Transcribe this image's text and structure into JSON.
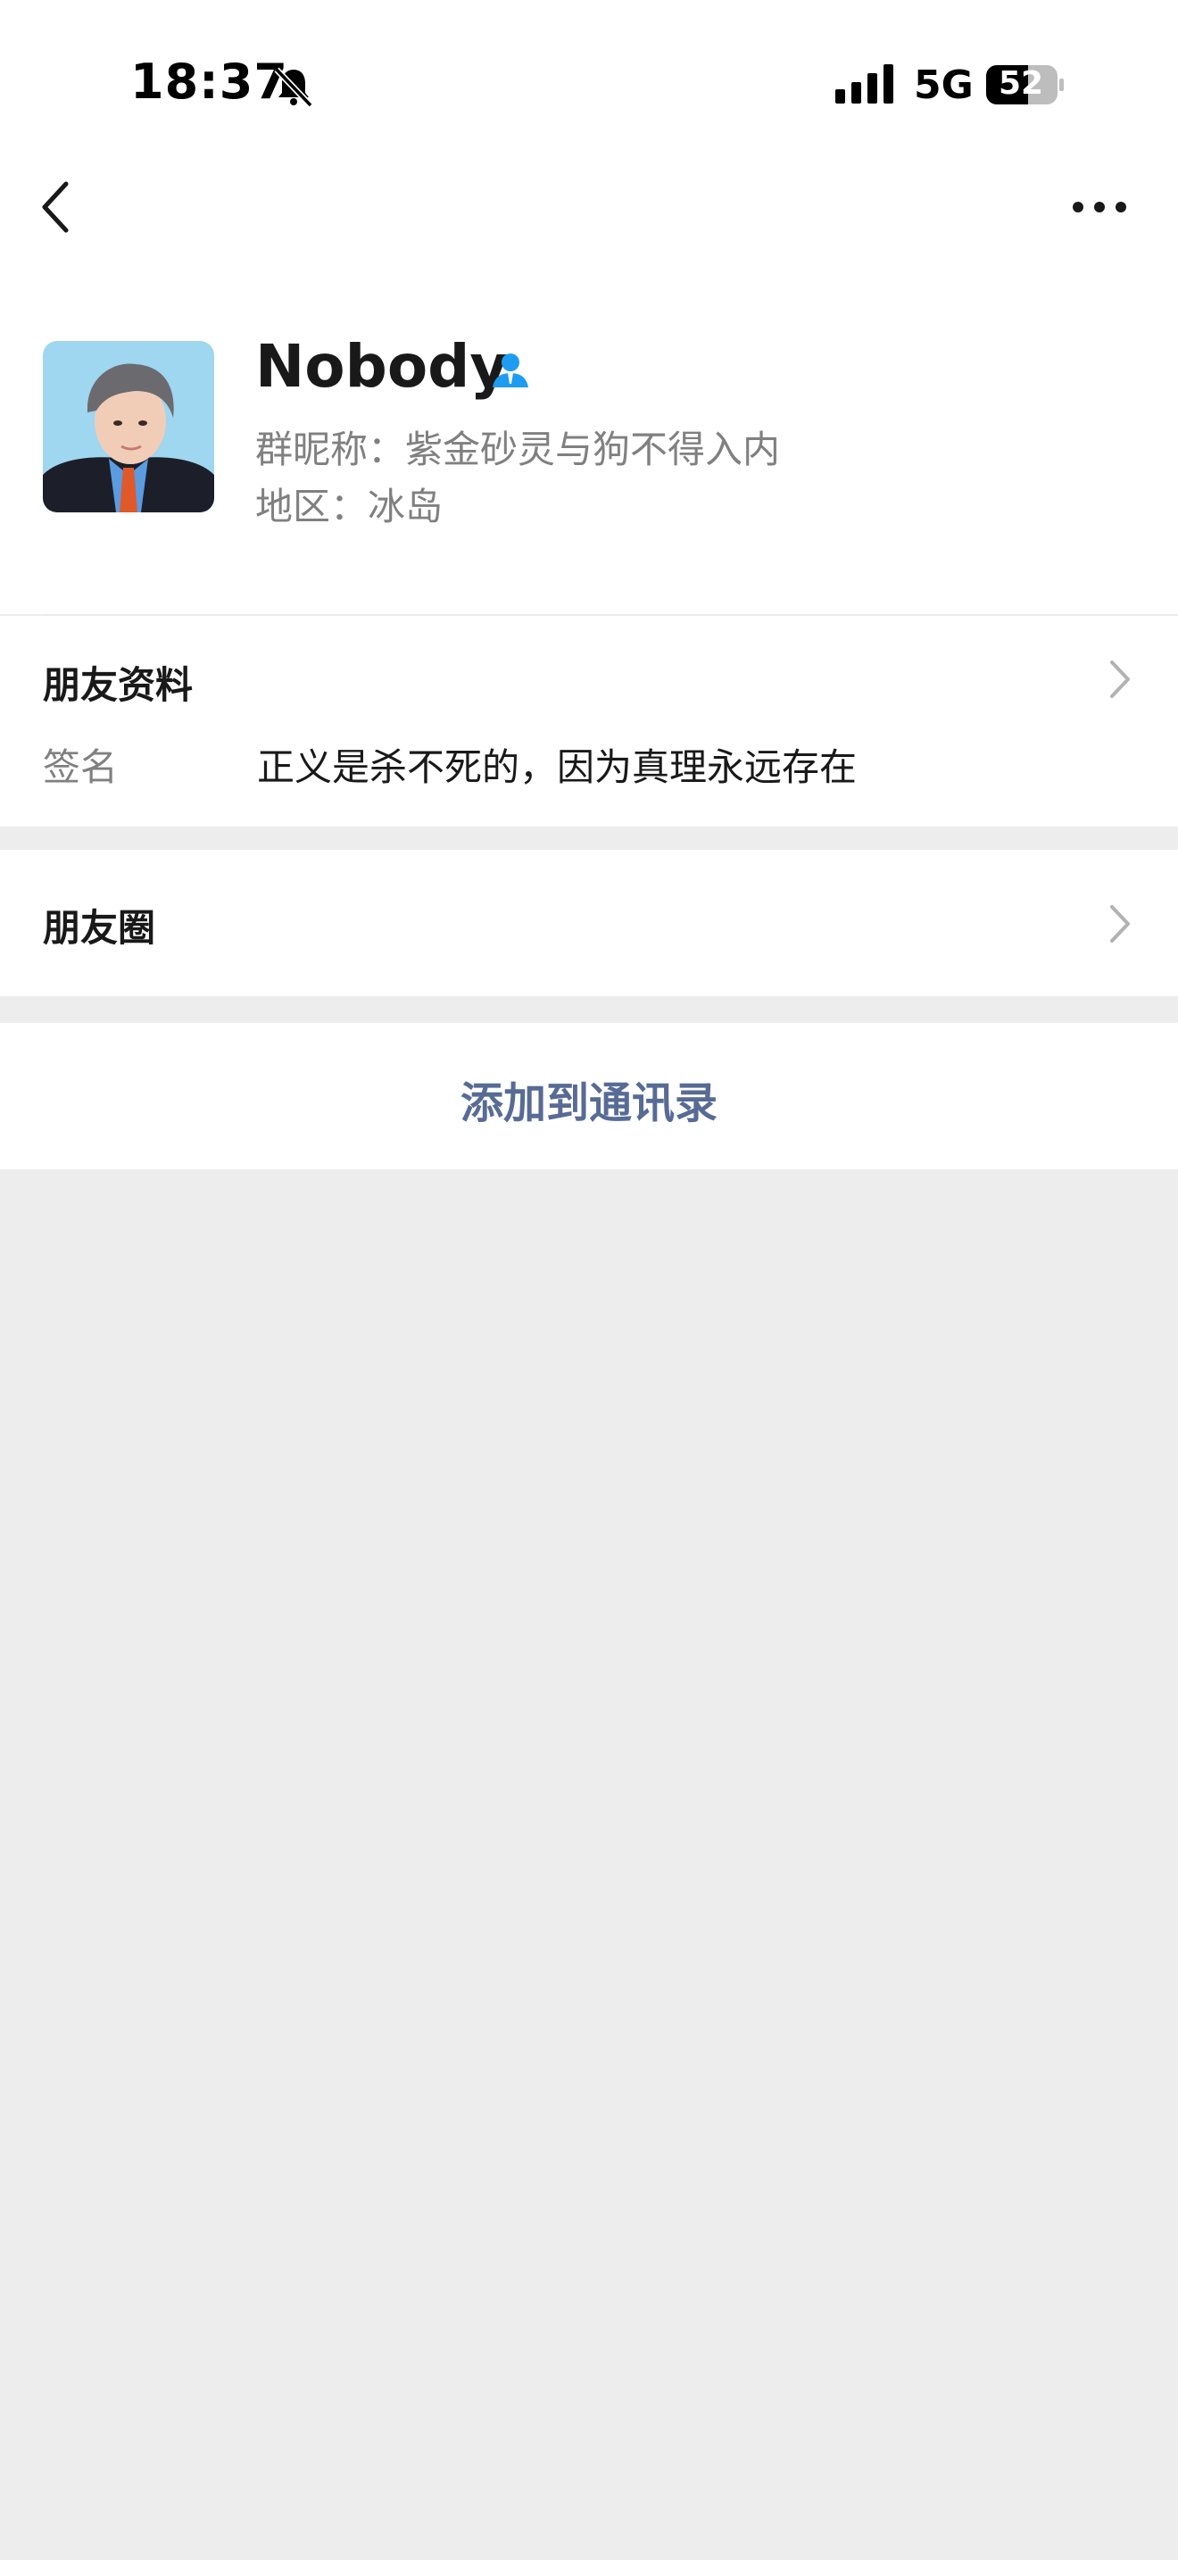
{
  "status_bar": {
    "time": "18:37",
    "network": "5G",
    "battery": "52"
  },
  "profile": {
    "name": "Nobody",
    "group_nickname": "群昵称：紫金砂灵与狗不得入内",
    "region": "地区：冰岛"
  },
  "info": {
    "title": "朋友资料",
    "signature_label": "签名",
    "signature_value": "正义是杀不死的，因为真理永远存在"
  },
  "moments": {
    "label": "朋友圈"
  },
  "actions": {
    "add_contact": "添加到通讯录"
  },
  "colors": {
    "link": "#576b95",
    "background": "#ededed",
    "secondary_text": "#808080",
    "verified_icon": "#1e9df0"
  },
  "icons": [
    "bell-slash-icon",
    "signal-icon",
    "battery-icon",
    "back-arrow-icon",
    "more-icon",
    "person-icon",
    "chevron-right-icon"
  ]
}
